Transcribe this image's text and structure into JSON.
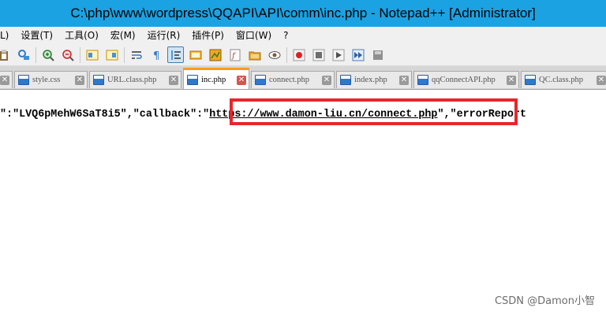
{
  "window": {
    "title": "C:\\php\\www\\wordpress\\QQAPI\\API\\comm\\inc.php - Notepad++ [Administrator]"
  },
  "menubar": {
    "items": [
      "L)",
      "设置(T)",
      "工具(O)",
      "宏(M)",
      "运行(R)",
      "插件(P)",
      "窗口(W)",
      "?"
    ]
  },
  "toolbar": {
    "icons": [
      "clipboard-icon",
      "find-replace-icon",
      "zoom-in-icon",
      "zoom-out-icon",
      "sync-vertical-icon",
      "sync-horizontal-icon",
      "word-wrap-icon",
      "show-all-chars-icon",
      "indent-guide-icon",
      "user-language-icon",
      "document-map-icon",
      "function-list-icon",
      "folder-workspace-icon",
      "monitoring-eye-icon",
      "record-macro-icon",
      "stop-record-icon",
      "playback-macro-icon",
      "run-macro-multiple-icon",
      "save-macro-icon"
    ],
    "colors": {
      "record": "#e02020",
      "stop": "#7a7a7a",
      "play": "#505050",
      "accent": "#2f79c9"
    }
  },
  "tabs": [
    {
      "label": "style.css",
      "active": false
    },
    {
      "label": "URL.class.php",
      "active": false
    },
    {
      "label": "inc.php",
      "active": true
    },
    {
      "label": "connect.php",
      "active": false
    },
    {
      "label": "index.php",
      "active": false
    },
    {
      "label": "qqConnectAPI.php",
      "active": false
    },
    {
      "label": "QC.class.php",
      "active": false
    }
  ],
  "editor": {
    "code_prefix": "\":\"LVQ6pMehW6SaT8i5\",\"callback\":\"",
    "code_url": "https://www.damon-liu.cn/connect.php",
    "code_suffix": "\",\"errorReport",
    "highlight_color": "#e8262b"
  },
  "watermark": {
    "text": "CSDN @Damon小智"
  }
}
